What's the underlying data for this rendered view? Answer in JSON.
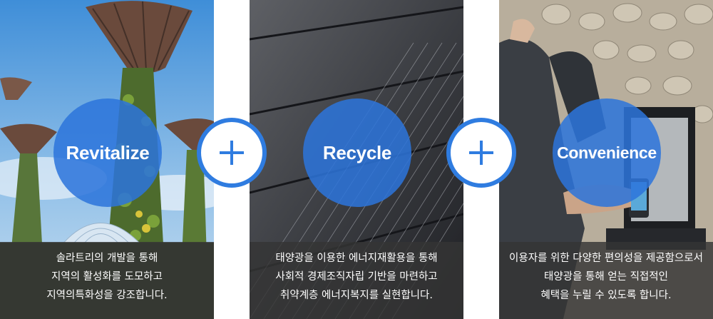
{
  "panels": [
    {
      "circle_label": "Revitalize",
      "photo": "supertree-grove-photo",
      "caption": [
        "솔라트리의 개발을 통해",
        "지역의 활성화를 도모하고",
        "지역의특화성을 강조합니다."
      ]
    },
    {
      "circle_label": "Recycle",
      "photo": "solar-panel-photo",
      "caption": [
        "태양광을 이용한 에너지재활용을 통해",
        "사회적 경제조직자립 기반을 마련하고",
        "취약계층 에너지복지를 실현합니다."
      ]
    },
    {
      "circle_label": "Convenience",
      "photo": "phone-charging-station-photo",
      "caption": [
        "이용자를 위한 다양한 편의성을 제공함으로서",
        "태양광을 통해 얻는 직접적인",
        "혜택을 누릴 수 있도록 합니다."
      ]
    }
  ],
  "connectors": [
    "plus-icon",
    "plus-icon"
  ],
  "colors": {
    "accent": "#2f7ce0",
    "circle": "#2c75db",
    "caption_bg": "#343434"
  }
}
